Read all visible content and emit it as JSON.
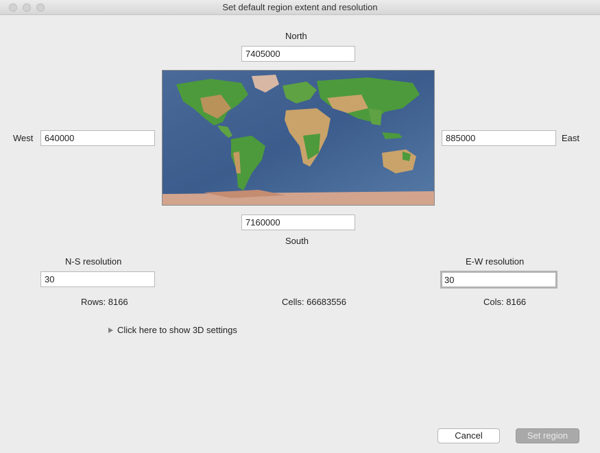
{
  "window": {
    "title": "Set default region extent and resolution"
  },
  "extent": {
    "north_label": "North",
    "north_value": "7405000",
    "south_label": "South",
    "south_value": "7160000",
    "west_label": "West",
    "west_value": "640000",
    "east_label": "East",
    "east_value": "885000"
  },
  "resolution": {
    "ns_label": "N-S resolution",
    "ns_value": "30",
    "ew_label": "E-W resolution",
    "ew_value": "30"
  },
  "stats": {
    "rows": "Rows: 8166",
    "cells": "Cells: 66683556",
    "cols": "Cols: 8166"
  },
  "settings_3d": {
    "label": "Click here to show 3D settings"
  },
  "buttons": {
    "cancel": "Cancel",
    "set_region": "Set region"
  },
  "icons": {
    "expander": "disclosure-triangle-icon",
    "map": "world-map-image"
  },
  "colors": {
    "ocean": "#3f5f8f",
    "land_green": "#4c9a3c",
    "land_tan": "#c9a36a",
    "ice": "#d8b8a8"
  }
}
